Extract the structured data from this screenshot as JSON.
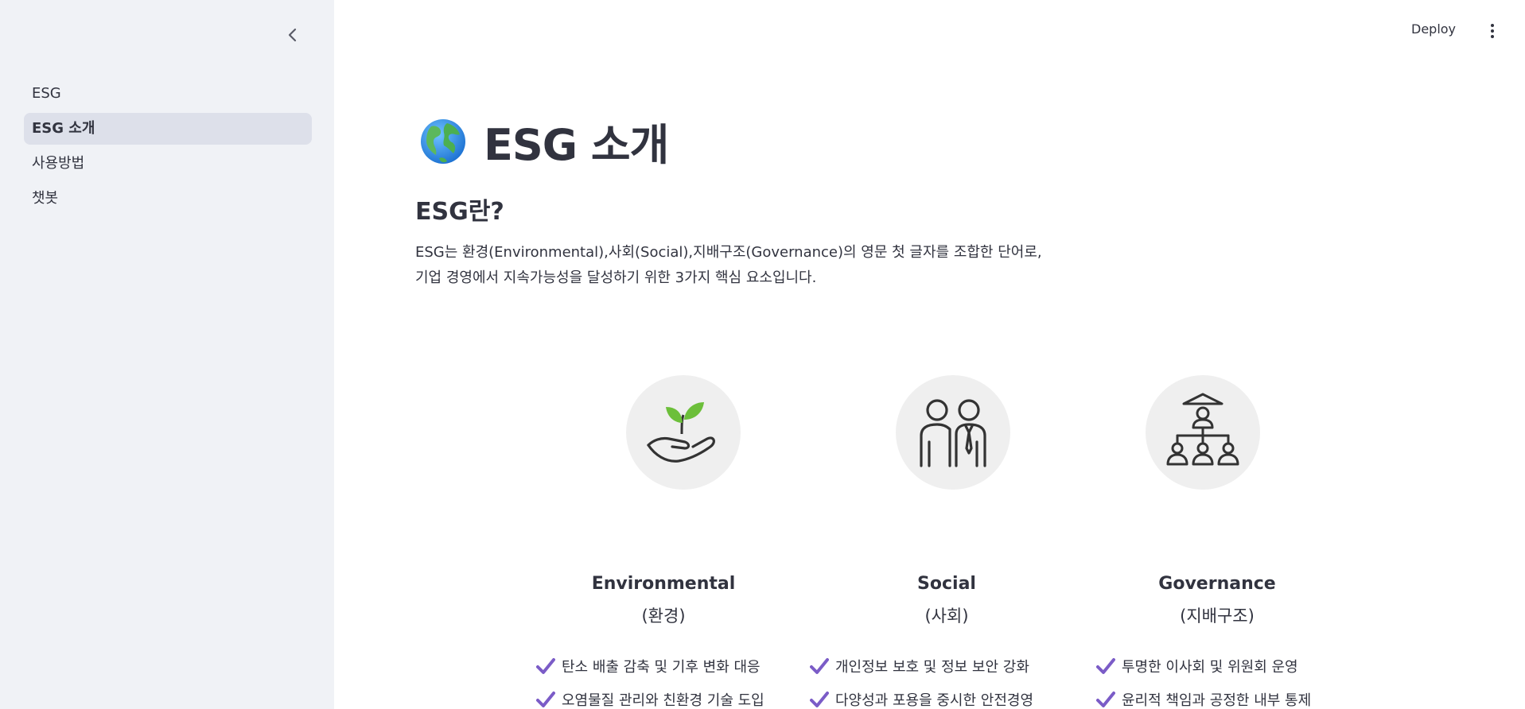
{
  "sidebar": {
    "items": [
      {
        "label": "ESG"
      },
      {
        "label": "ESG 소개"
      },
      {
        "label": "사용방법"
      },
      {
        "label": "챗봇"
      }
    ],
    "active_index": 1
  },
  "header": {
    "deploy_label": "Deploy"
  },
  "main": {
    "title": "ESG 소개",
    "subheading": "ESG란?",
    "intro_line1": "ESG는 환경(Environmental),사회(Social),지배구조(Governance)의 영문 첫 글자를 조합한 단어로,",
    "intro_line2": "기업 경영에서 지속가능성을 달성하기 위한 3가지 핵심 요소입니다.",
    "pillars": [
      {
        "title": "Environmental",
        "subtitle": "(환경)",
        "icon": "plant-hand-icon",
        "bullets": [
          "탄소 배출 감축 및 기후 변화 대응",
          "오염물질 관리와 친환경 기술 도입"
        ]
      },
      {
        "title": "Social",
        "subtitle": "(사회)",
        "icon": "people-icon",
        "bullets": [
          "개인정보 보호 및 정보 보안 강화",
          "다양성과 포용을 중시한 안전경영"
        ]
      },
      {
        "title": "Governance",
        "subtitle": "(지배구조)",
        "icon": "org-chart-icon",
        "bullets": [
          "투명한 이사회 및 위원회 운영",
          "윤리적 책임과 공정한 내부 통제"
        ]
      }
    ]
  },
  "colors": {
    "sidebar_bg": "#f0f2f6",
    "active_item_bg": "#dde0ea",
    "text": "#31333f",
    "check": "#7b5cc7",
    "leaf": "#6cbf3a"
  }
}
